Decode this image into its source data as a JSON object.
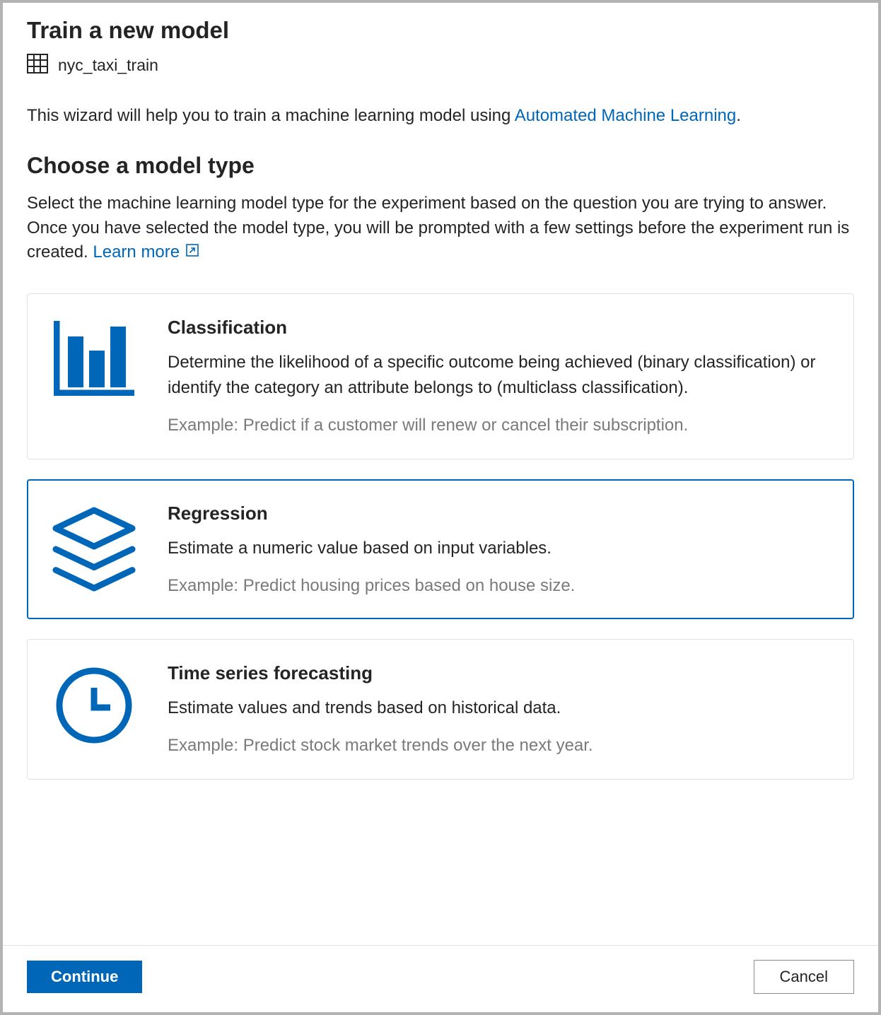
{
  "title": "Train a new model",
  "dataset": {
    "name": "nyc_taxi_train"
  },
  "intro": {
    "text_before": "This wizard will help you to train a machine learning model using ",
    "link_text": "Automated Machine Learning",
    "text_after": "."
  },
  "section": {
    "title": "Choose a model type",
    "desc_before": "Select the machine learning model type for the experiment based on the question you are trying to answer. Once you have selected the model type, you will be prompted with a few settings before the experiment run is created. ",
    "learn_more": "Learn more"
  },
  "cards": [
    {
      "id": "classification",
      "title": "Classification",
      "desc": "Determine the likelihood of a specific outcome being achieved (binary classification) or identify the category an attribute belongs to (multiclass classification).",
      "example": "Example: Predict if a customer will renew or cancel their subscription.",
      "selected": false,
      "icon": "bar-chart-icon"
    },
    {
      "id": "regression",
      "title": "Regression",
      "desc": "Estimate a numeric value based on input variables.",
      "example": "Example: Predict housing prices based on house size.",
      "selected": true,
      "icon": "layers-icon"
    },
    {
      "id": "timeseries",
      "title": "Time series forecasting",
      "desc": "Estimate values and trends based on historical data.",
      "example": "Example: Predict stock market trends over the next year.",
      "selected": false,
      "icon": "clock-icon"
    }
  ],
  "footer": {
    "continue": "Continue",
    "cancel": "Cancel"
  },
  "colors": {
    "accent": "#0067b8",
    "text": "#242424",
    "muted": "#7a7a7a",
    "border": "#e1e1e1"
  }
}
